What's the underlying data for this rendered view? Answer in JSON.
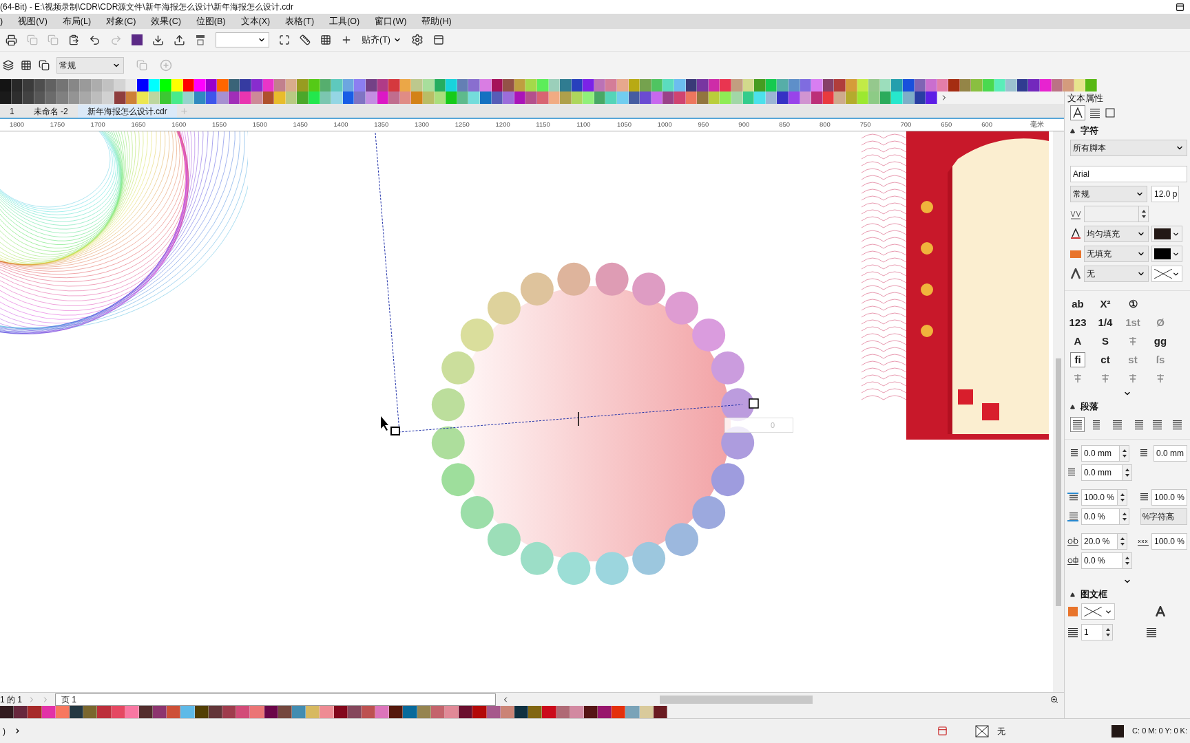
{
  "window": {
    "title": "(64-Bit) - E:\\视频录制\\CDR\\CDR源文件\\新年海报怎么设计\\新年海报怎么设计.cdr"
  },
  "menu": [
    ")",
    "视图(V)",
    "布局(L)",
    "对象(C)",
    "效果(C)",
    "位图(B)",
    "文本(X)",
    "表格(T)",
    "工具(O)",
    "窗口(W)",
    "帮助(H)"
  ],
  "toolbar": {
    "snap_label": "贴齐(T)"
  },
  "property_bar": {
    "style": "常规"
  },
  "document_tabs": [
    {
      "label": "1",
      "selected": false
    },
    {
      "label": "未命名 -2",
      "selected": false
    },
    {
      "label": "新年海报怎么设计.cdr",
      "selected": true
    }
  ],
  "ruler": {
    "labels": [
      "1800",
      "1750",
      "1700",
      "1650",
      "1600",
      "1550",
      "1500",
      "1450",
      "1400",
      "1350",
      "1300",
      "1250",
      "1200",
      "1150",
      "1100",
      "1050",
      "1000",
      "950",
      "900",
      "850",
      "800",
      "750",
      "700",
      "650",
      "600"
    ],
    "unit": "毫米"
  },
  "canvas": {
    "offset_field": "0"
  },
  "page_nav": {
    "counter": "1 的 1",
    "page_tab": "页 1"
  },
  "panel": {
    "title": "文本属性",
    "character": {
      "heading": "字符",
      "script": "所有脚本",
      "font": "Arial",
      "style": "常规",
      "size": "12.0 p",
      "fill_type": "均匀填充",
      "background_fill": "无填充",
      "outline": "无",
      "glyph_rows": [
        [
          {
            "kind": "text",
            "label": "ab",
            "disabled": false,
            "selected": false
          },
          {
            "kind": "text",
            "label": "X²",
            "disabled": false,
            "selected": false
          },
          {
            "kind": "text",
            "label": "①",
            "disabled": false,
            "selected": false
          }
        ],
        [
          {
            "kind": "text",
            "label": "123",
            "disabled": false,
            "selected": false
          },
          {
            "kind": "text",
            "label": "1/4",
            "disabled": false,
            "selected": false
          },
          {
            "kind": "text",
            "label": "1st",
            "disabled": true,
            "selected": false
          },
          {
            "kind": "text",
            "label": "Ø",
            "disabled": true,
            "selected": false
          }
        ],
        [
          {
            "kind": "text",
            "label": "A",
            "disabled": false,
            "selected": false
          },
          {
            "kind": "text",
            "label": "S",
            "disabled": false,
            "selected": false
          },
          {
            "kind": "icon",
            "disabled": true,
            "selected": false
          },
          {
            "kind": "text",
            "label": "gg",
            "disabled": false,
            "selected": false
          }
        ],
        [
          {
            "kind": "text",
            "label": "fi",
            "disabled": false,
            "selected": true
          },
          {
            "kind": "text",
            "label": "ct",
            "disabled": false,
            "selected": false
          },
          {
            "kind": "text",
            "label": "st",
            "disabled": true,
            "selected": false
          },
          {
            "kind": "text",
            "label": "ſs",
            "disabled": true,
            "selected": false
          }
        ],
        [
          {
            "kind": "icon",
            "disabled": true,
            "selected": false
          },
          {
            "kind": "icon",
            "disabled": true,
            "selected": false
          },
          {
            "kind": "icon",
            "disabled": true,
            "selected": false
          },
          {
            "kind": "icon",
            "disabled": true,
            "selected": false
          }
        ]
      ]
    },
    "paragraph": {
      "heading": "段落",
      "alignments": [
        {
          "selected": true
        },
        {
          "selected": false
        },
        {
          "selected": false
        },
        {
          "selected": false
        },
        {
          "selected": false
        },
        {
          "selected": false
        }
      ],
      "first_indent": "0.0 mm",
      "right_indent": "0.0 mm",
      "left_indent": "0.0 mm",
      "line_spacing": "100.0 %",
      "before_spacing": "100.0 %",
      "after_spacing": "0.0 %",
      "spacing_unit": "%字符高",
      "char_spacing": "20.0 %",
      "word_spacing": "100.0 %",
      "language_spacing": "0.0 %"
    },
    "frame": {
      "heading": "图文框",
      "columns": "1"
    }
  },
  "status_bar": {
    "left": ")",
    "fill_label": "无",
    "color_readout": "C: 0 M: 0 Y: 0 K:"
  }
}
